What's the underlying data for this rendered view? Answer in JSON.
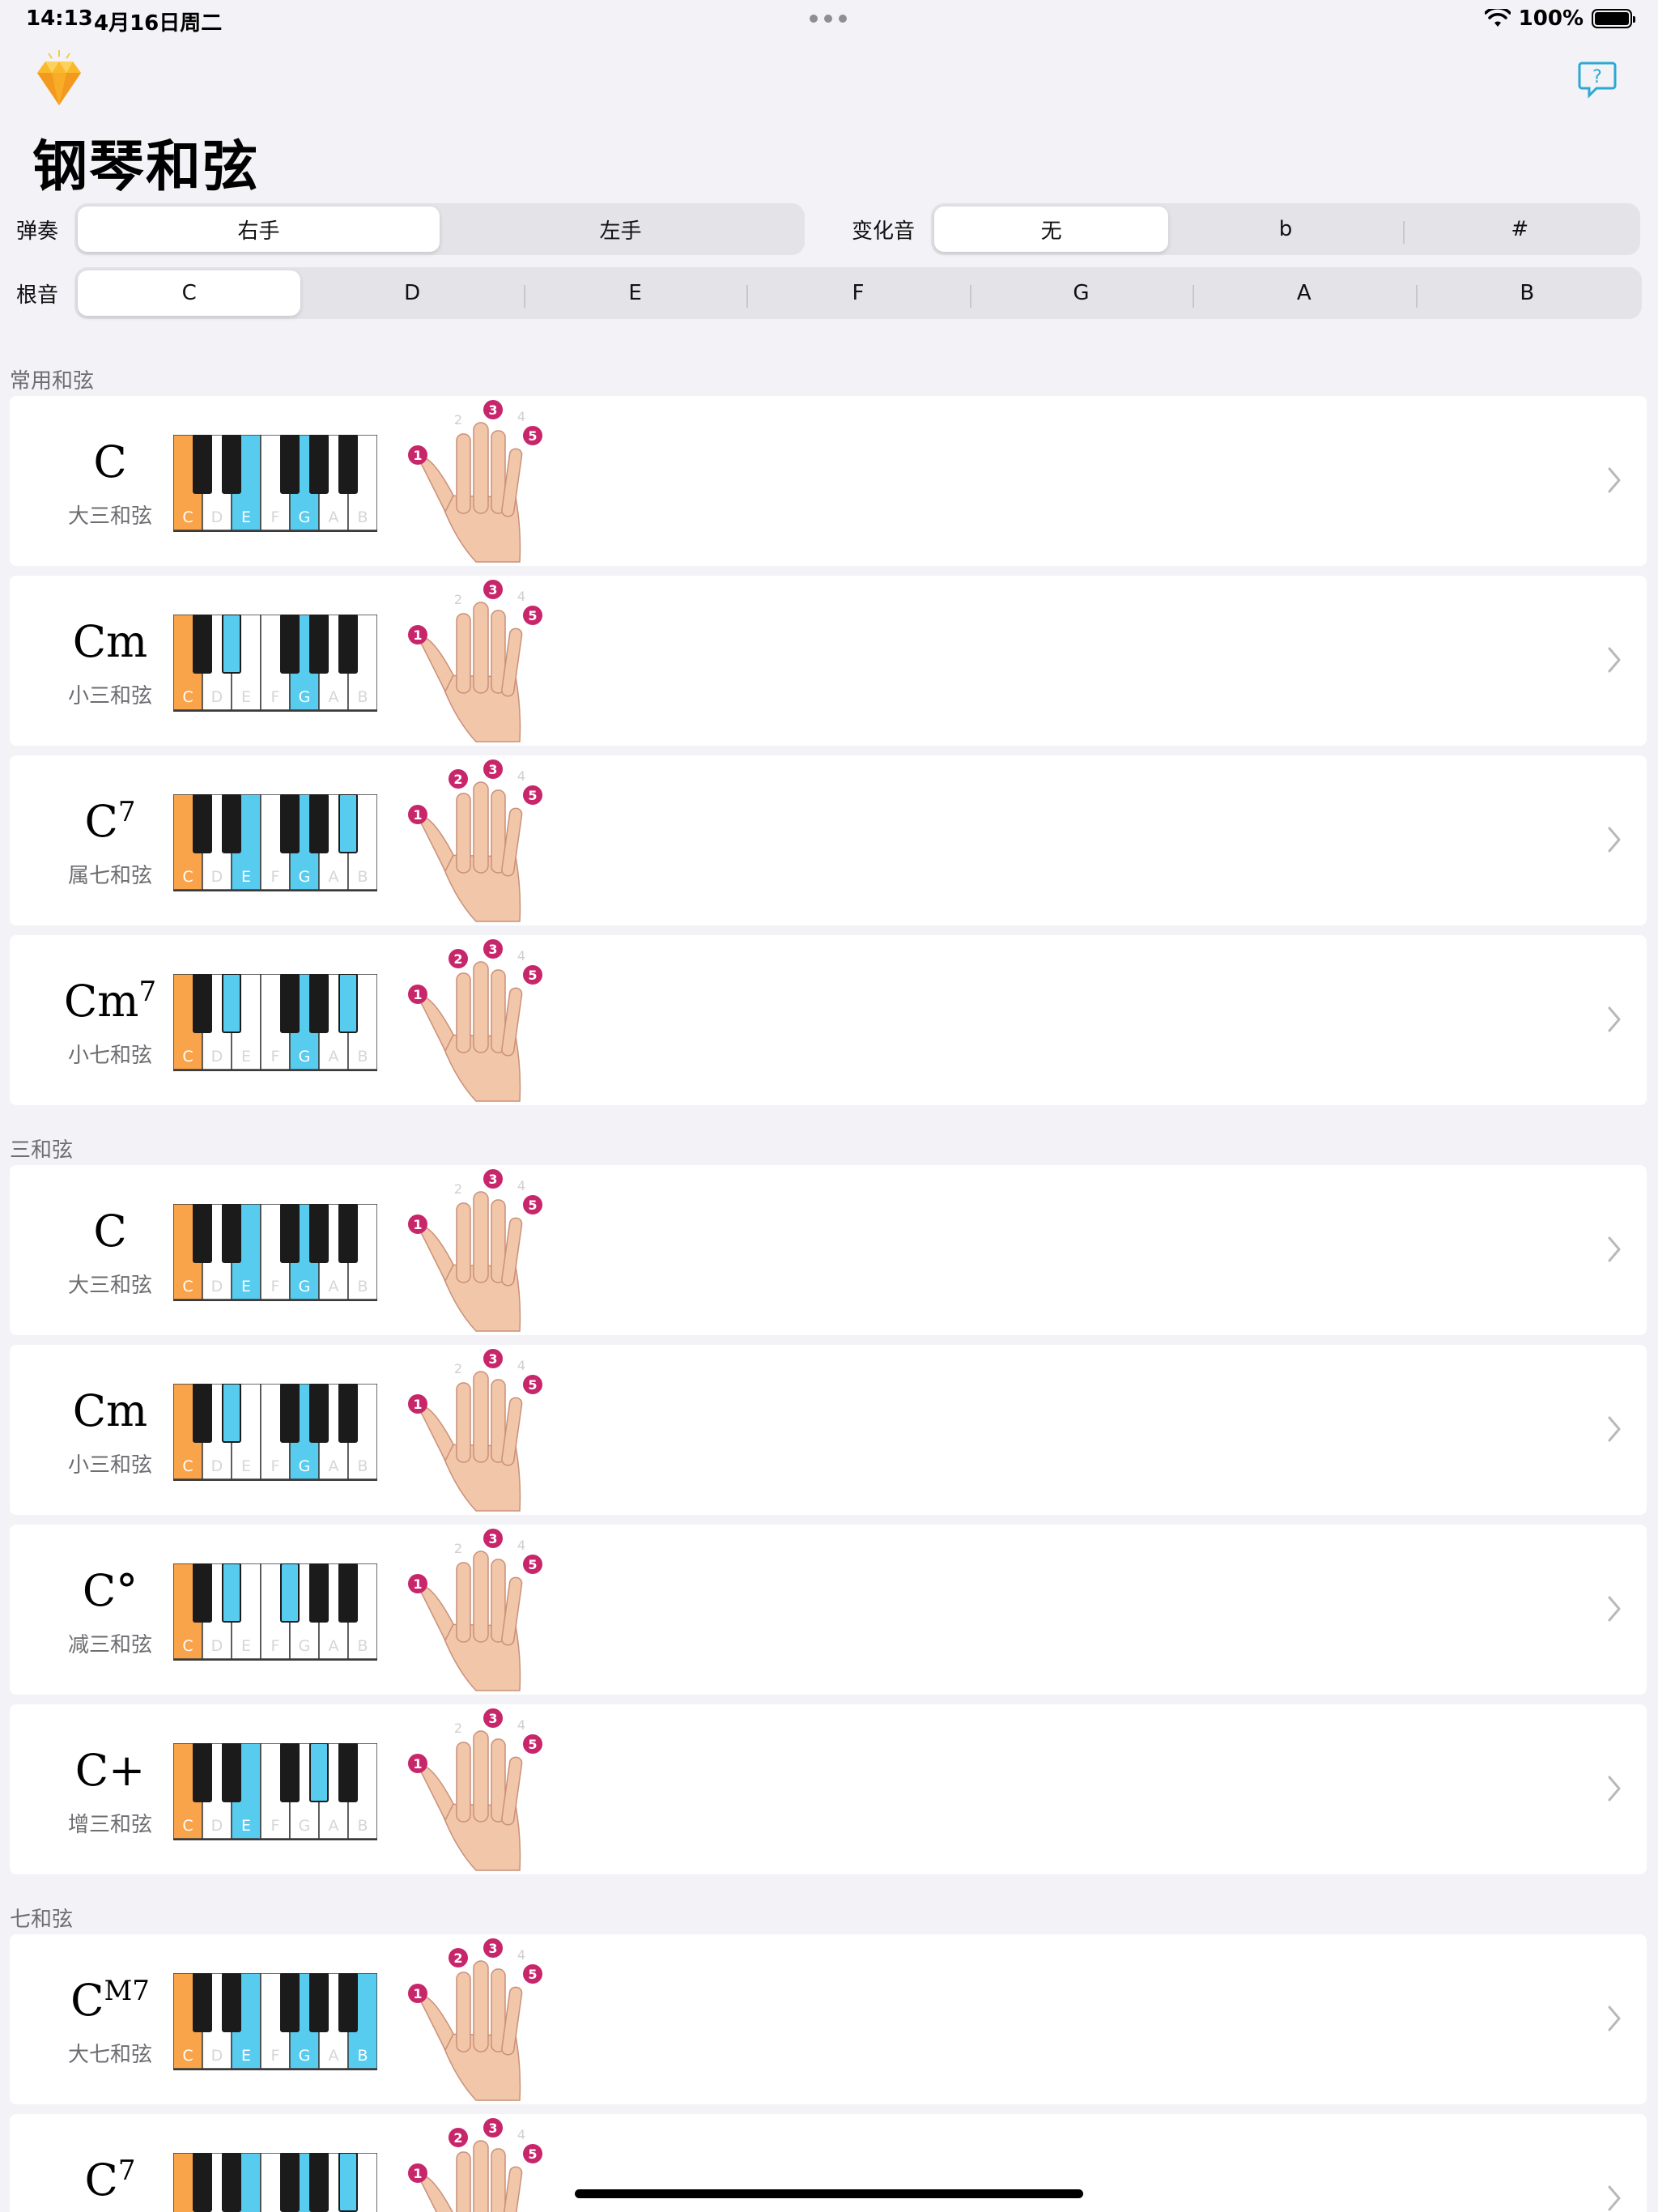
{
  "status": {
    "time": "14:13",
    "date": "4月16日周二",
    "battery": "100%"
  },
  "app": {
    "title": "钢琴和弦"
  },
  "controls": {
    "hand_label": "弹奏",
    "hands": [
      "右手",
      "左手"
    ],
    "hand_selected": 0,
    "accidental_label": "变化音",
    "accidentals": [
      "无",
      "b",
      "#"
    ],
    "accidental_selected": 0,
    "root_label": "根音",
    "roots": [
      "C",
      "D",
      "E",
      "F",
      "G",
      "A",
      "B"
    ],
    "root_selected": 0
  },
  "white_key_labels": [
    "C",
    "D",
    "E",
    "F",
    "G",
    "A",
    "B"
  ],
  "colors": {
    "root": "#f9a34a",
    "note": "#58ccef",
    "finger": "#c8266b",
    "accent": "#2aa9d2",
    "skin": "#f2c6a8"
  },
  "sections": [
    {
      "title": "常用和弦",
      "rows": [
        {
          "name": "C",
          "sup": "",
          "subtitle": "大三和弦",
          "white": [
            "root",
            "",
            "note",
            "",
            "note",
            "",
            ""
          ],
          "black": [
            "",
            "",
            "",
            "",
            ""
          ],
          "fingers": [
            1,
            3,
            5
          ]
        },
        {
          "name": "Cm",
          "sup": "",
          "subtitle": "小三和弦",
          "white": [
            "root",
            "",
            "",
            "",
            "note",
            "",
            ""
          ],
          "black": [
            "",
            "note",
            "",
            "",
            ""
          ],
          "fingers": [
            1,
            3,
            5
          ]
        },
        {
          "name": "C",
          "sup": "7",
          "subtitle": "属七和弦",
          "white": [
            "root",
            "",
            "note",
            "",
            "note",
            "",
            ""
          ],
          "black": [
            "",
            "",
            "",
            "",
            "note"
          ],
          "fingers": [
            1,
            2,
            3,
            5
          ]
        },
        {
          "name": "Cm",
          "sup": "7",
          "subtitle": "小七和弦",
          "white": [
            "root",
            "",
            "",
            "",
            "note",
            "",
            ""
          ],
          "black": [
            "",
            "note",
            "",
            "",
            "note"
          ],
          "fingers": [
            1,
            2,
            3,
            5
          ]
        }
      ]
    },
    {
      "title": "三和弦",
      "rows": [
        {
          "name": "C",
          "sup": "",
          "subtitle": "大三和弦",
          "white": [
            "root",
            "",
            "note",
            "",
            "note",
            "",
            ""
          ],
          "black": [
            "",
            "",
            "",
            "",
            ""
          ],
          "fingers": [
            1,
            3,
            5
          ]
        },
        {
          "name": "Cm",
          "sup": "",
          "subtitle": "小三和弦",
          "white": [
            "root",
            "",
            "",
            "",
            "note",
            "",
            ""
          ],
          "black": [
            "",
            "note",
            "",
            "",
            ""
          ],
          "fingers": [
            1,
            3,
            5
          ]
        },
        {
          "name": "C°",
          "sup": "",
          "subtitle": "减三和弦",
          "white": [
            "root",
            "",
            "",
            "",
            "",
            "",
            ""
          ],
          "black": [
            "",
            "note",
            "note",
            "",
            ""
          ],
          "fingers": [
            1,
            3,
            5
          ]
        },
        {
          "name": "C+",
          "sup": "",
          "subtitle": "增三和弦",
          "white": [
            "root",
            "",
            "note",
            "",
            "",
            "",
            ""
          ],
          "black": [
            "",
            "",
            "",
            "note",
            ""
          ],
          "fingers": [
            1,
            3,
            5
          ]
        }
      ]
    },
    {
      "title": "七和弦",
      "rows": [
        {
          "name": "C",
          "sup": "M7",
          "subtitle": "大七和弦",
          "white": [
            "root",
            "",
            "note",
            "",
            "note",
            "",
            "note"
          ],
          "black": [
            "",
            "",
            "",
            "",
            ""
          ],
          "fingers": [
            1,
            2,
            3,
            5
          ]
        },
        {
          "name": "C",
          "sup": "7",
          "subtitle": "",
          "white": [
            "root",
            "",
            "note",
            "",
            "note",
            "",
            ""
          ],
          "black": [
            "",
            "",
            "",
            "",
            "note"
          ],
          "fingers": [
            1,
            2,
            3,
            5
          ]
        }
      ]
    }
  ]
}
